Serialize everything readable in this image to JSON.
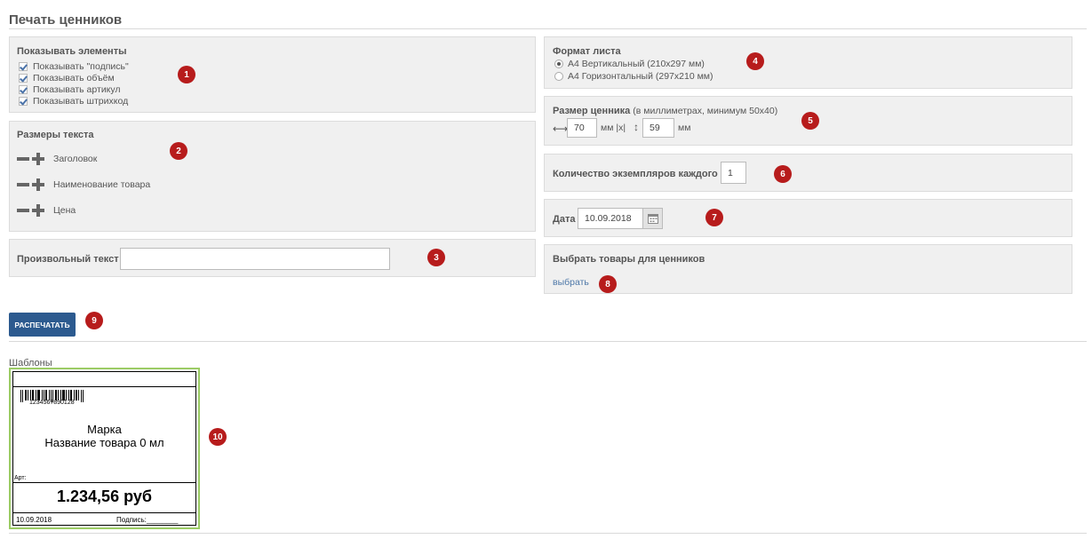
{
  "page_title": "Печать ценников",
  "show_elements": {
    "title": "Показывать элементы",
    "items": [
      {
        "label": "Показывать \"подпись\"",
        "checked": true
      },
      {
        "label": "Показывать объём",
        "checked": true
      },
      {
        "label": "Показывать артикул",
        "checked": true
      },
      {
        "label": "Показывать штрихкод",
        "checked": true
      }
    ]
  },
  "text_sizes": {
    "title": "Размеры текста",
    "items": [
      "Заголовок",
      "Наименование товара",
      "Цена"
    ]
  },
  "custom_text": {
    "label": "Произвольный текст",
    "value": ""
  },
  "sheet_format": {
    "title": "Формат листа",
    "options": [
      {
        "label": "А4 Вертикальный (210x297 мм)",
        "selected": true
      },
      {
        "label": "А4 Горизонтальный (297x210 мм)",
        "selected": false
      }
    ]
  },
  "tag_size": {
    "title": "Размер ценника",
    "hint": "(в миллиметрах, минимум 50x40)",
    "width": "70",
    "height": "59",
    "unit_mid": "мм |x|",
    "unit_end": "мм"
  },
  "copies": {
    "label": "Количество экземпляров каждого",
    "value": "1"
  },
  "date": {
    "label": "Дата",
    "value": "10.09.2018"
  },
  "select_goods": {
    "title": "Выбрать товары для ценников",
    "link": "выбрать"
  },
  "print_button": "РАСПЕЧАТАТЬ",
  "templates": {
    "title": "Шаблоны",
    "preview": {
      "barcode": "1234567890128",
      "brand": "Марка",
      "product": "Название товара 0 мл",
      "art_label": "Арт:",
      "price": "1.234,56 руб",
      "date": "10.09.2018",
      "signature": "Подпись:________"
    }
  },
  "badges": [
    "1",
    "2",
    "3",
    "4",
    "5",
    "6",
    "7",
    "8",
    "9",
    "10"
  ],
  "colors": {
    "badge": "#b71c1c",
    "button": "#2c5a8f",
    "panel": "#f0f0f0",
    "link": "#4e78a8",
    "template_border": "#9ccc65"
  }
}
